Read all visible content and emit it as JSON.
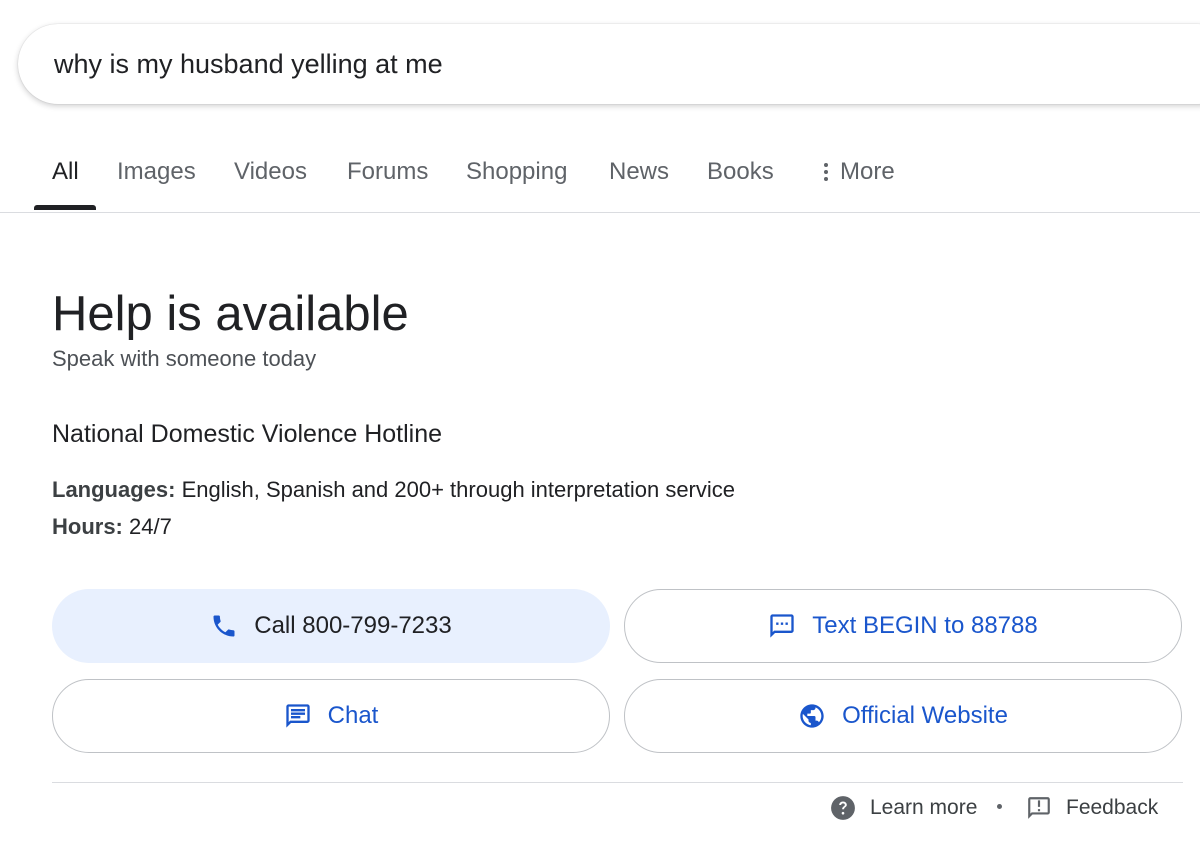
{
  "search": {
    "query": "why is my husband yelling at me"
  },
  "tabs": [
    {
      "label": "All",
      "active": true
    },
    {
      "label": "Images"
    },
    {
      "label": "Videos"
    },
    {
      "label": "Forums"
    },
    {
      "label": "Shopping"
    },
    {
      "label": "News"
    },
    {
      "label": "Books"
    },
    {
      "label": "More",
      "icon": "kebab-icon"
    }
  ],
  "help": {
    "title": "Help is available",
    "subtitle": "Speak with someone today",
    "org_name": "National Domestic Violence Hotline",
    "languages_label": "Languages:",
    "languages_value": " English, Spanish and 200+ through interpretation service",
    "hours_label": "Hours:",
    "hours_value": " 24/7"
  },
  "actions": {
    "call": {
      "label": "Call 800-799-7233",
      "icon": "phone-icon"
    },
    "text": {
      "label": "Text BEGIN to 88788",
      "icon": "sms-icon"
    },
    "chat": {
      "label": "Chat",
      "icon": "chat-icon"
    },
    "website": {
      "label": "Official Website",
      "icon": "globe-icon"
    }
  },
  "footer": {
    "learn_more": "Learn more",
    "feedback": "Feedback"
  },
  "colors": {
    "link_blue": "#1a56cc",
    "call_bg": "#e8f0fe",
    "text_primary": "#202124",
    "text_secondary": "#5f6368"
  }
}
